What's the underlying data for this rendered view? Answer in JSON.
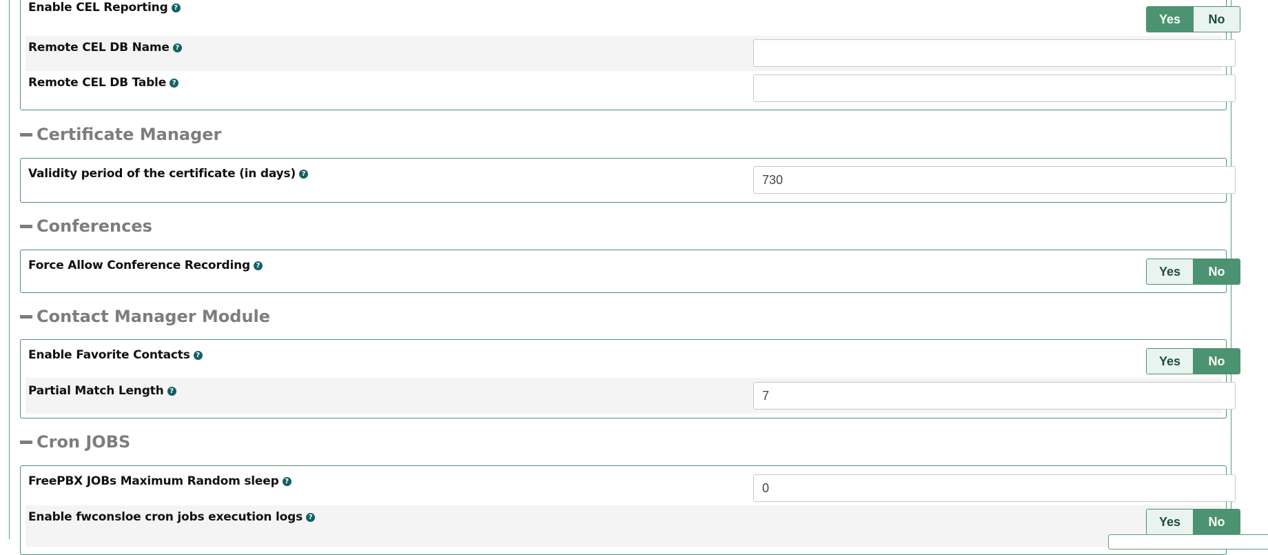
{
  "cdr_cel": {
    "enable_cel_reporting": {
      "label": "Enable CEL Reporting",
      "yes": "Yes",
      "no": "No",
      "selected": "Yes"
    },
    "remote_cel_db_name": {
      "label": "Remote CEL DB Name",
      "value": ""
    },
    "remote_cel_db_table": {
      "label": "Remote CEL DB Table",
      "value": ""
    }
  },
  "certificate_manager": {
    "title": "Certificate Manager",
    "validity_period": {
      "label": "Validity period of the certificate (in days)",
      "value": "730"
    }
  },
  "conferences": {
    "title": "Conferences",
    "force_allow_recording": {
      "label": "Force Allow Conference Recording",
      "yes": "Yes",
      "no": "No",
      "selected": "No"
    }
  },
  "contact_manager": {
    "title": "Contact Manager Module",
    "enable_favorite_contacts": {
      "label": "Enable Favorite Contacts",
      "yes": "Yes",
      "no": "No",
      "selected": "No"
    },
    "partial_match_length": {
      "label": "Partial Match Length",
      "value": "7"
    }
  },
  "cron_jobs": {
    "title": "Cron JOBS",
    "max_random_sleep": {
      "label": "FreePBX JOBs Maximum Random sleep",
      "value": "0"
    },
    "execution_logs": {
      "label": "Enable fwconsloe cron jobs execution logs",
      "yes": "Yes",
      "no": "No",
      "selected": "No"
    }
  },
  "help_glyph": "?",
  "icons": {
    "help": "question-circle-icon",
    "collapse": "minus-icon"
  },
  "colors": {
    "accent": "#4b9371",
    "help": "#136066",
    "section_header": "#7d7d7d"
  }
}
